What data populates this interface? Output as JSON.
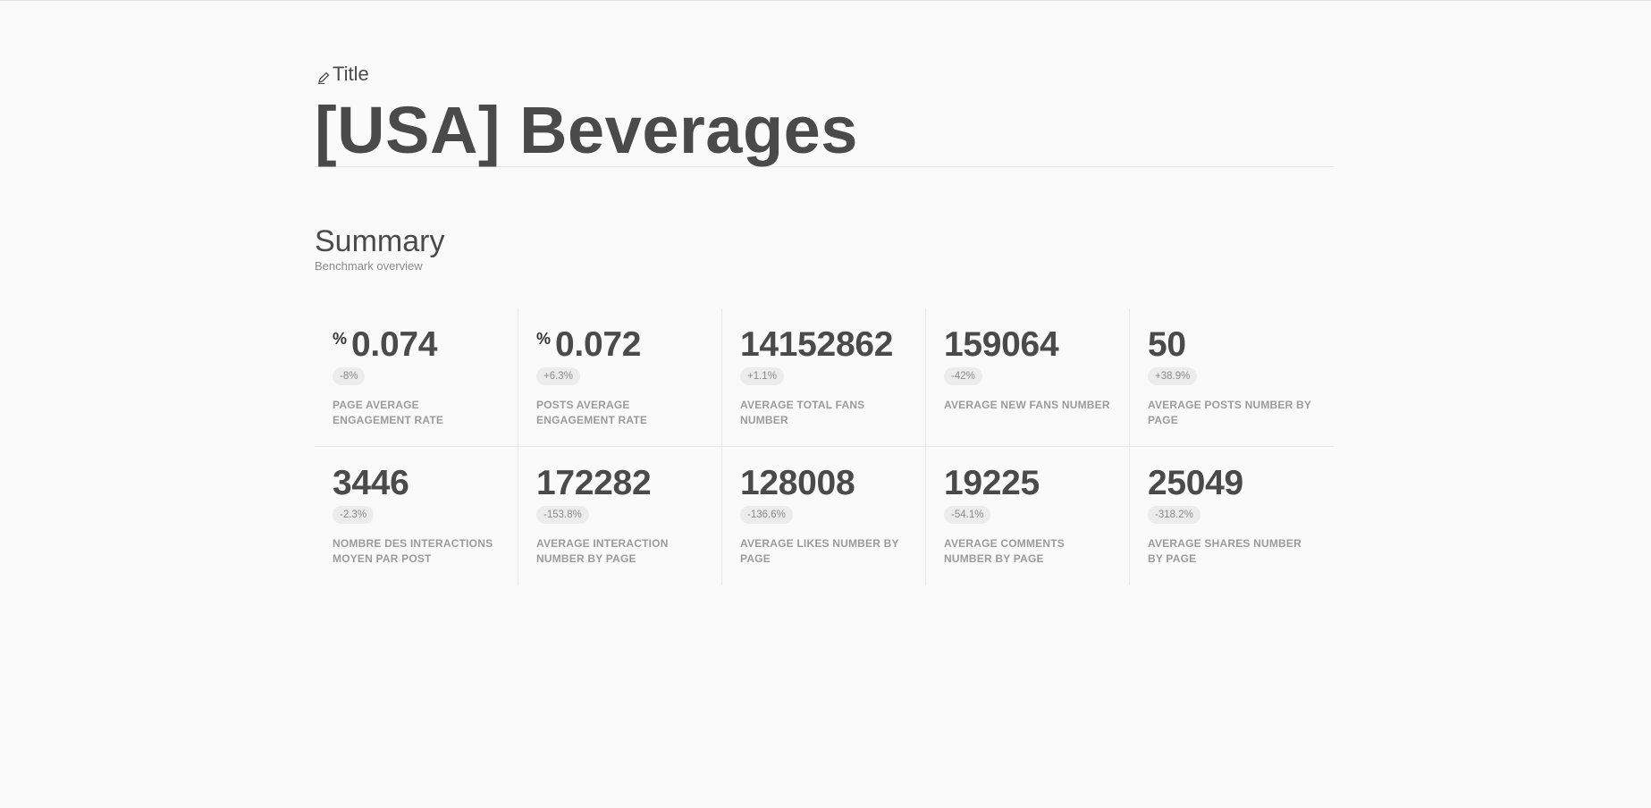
{
  "header": {
    "title_label": "Title",
    "page_title": "[USA] Beverages"
  },
  "summary": {
    "heading": "Summary",
    "subheading": "Benchmark overview"
  },
  "metrics": [
    {
      "prefix": "%",
      "value": "0.074",
      "change": "-8%",
      "label": "PAGE AVERAGE ENGAGEMENT RATE"
    },
    {
      "prefix": "%",
      "value": "0.072",
      "change": "+6.3%",
      "label": "POSTS AVERAGE ENGAGEMENT RATE"
    },
    {
      "prefix": "",
      "value": "14152862",
      "change": "+1.1%",
      "label": "AVERAGE TOTAL FANS NUMBER"
    },
    {
      "prefix": "",
      "value": "159064",
      "change": "-42%",
      "label": "AVERAGE NEW FANS NUMBER"
    },
    {
      "prefix": "",
      "value": "50",
      "change": "+38.9%",
      "label": "AVERAGE POSTS NUMBER BY PAGE"
    },
    {
      "prefix": "",
      "value": "3446",
      "change": "-2.3%",
      "label": "NOMBRE DES INTERACTIONS MOYEN PAR POST"
    },
    {
      "prefix": "",
      "value": "172282",
      "change": "-153.8%",
      "label": "AVERAGE INTERACTION NUMBER BY PAGE"
    },
    {
      "prefix": "",
      "value": "128008",
      "change": "-136.6%",
      "label": "AVERAGE LIKES NUMBER BY PAGE"
    },
    {
      "prefix": "",
      "value": "19225",
      "change": "-54.1%",
      "label": "AVERAGE COMMENTS NUMBER BY PAGE"
    },
    {
      "prefix": "",
      "value": "25049",
      "change": "-318.2%",
      "label": "AVERAGE SHARES NUMBER BY PAGE"
    }
  ],
  "icons": {
    "edit": "pencil-icon"
  }
}
